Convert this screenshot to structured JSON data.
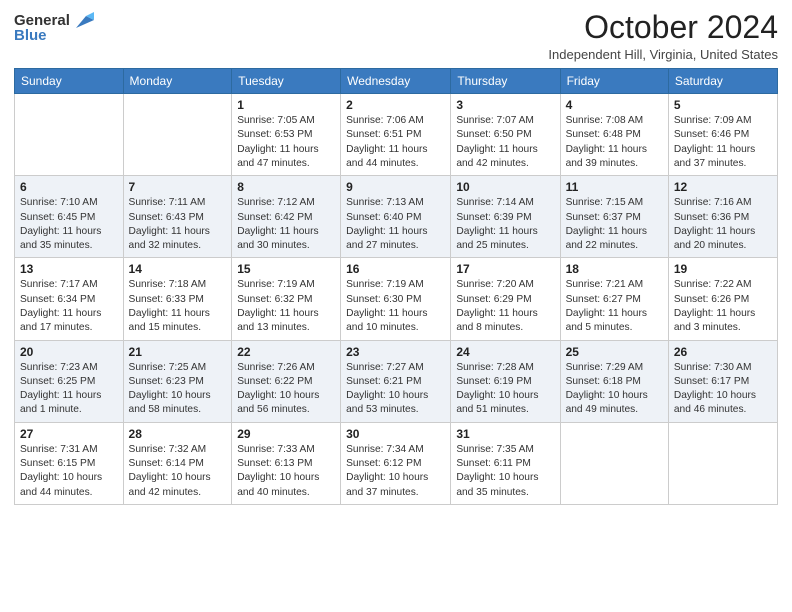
{
  "logo": {
    "general": "General",
    "blue": "Blue"
  },
  "header": {
    "title": "October 2024",
    "subtitle": "Independent Hill, Virginia, United States"
  },
  "weekdays": [
    "Sunday",
    "Monday",
    "Tuesday",
    "Wednesday",
    "Thursday",
    "Friday",
    "Saturday"
  ],
  "weeks": [
    [
      {
        "day": "",
        "detail": ""
      },
      {
        "day": "",
        "detail": ""
      },
      {
        "day": "1",
        "detail": "Sunrise: 7:05 AM\nSunset: 6:53 PM\nDaylight: 11 hours and 47 minutes."
      },
      {
        "day": "2",
        "detail": "Sunrise: 7:06 AM\nSunset: 6:51 PM\nDaylight: 11 hours and 44 minutes."
      },
      {
        "day": "3",
        "detail": "Sunrise: 7:07 AM\nSunset: 6:50 PM\nDaylight: 11 hours and 42 minutes."
      },
      {
        "day": "4",
        "detail": "Sunrise: 7:08 AM\nSunset: 6:48 PM\nDaylight: 11 hours and 39 minutes."
      },
      {
        "day": "5",
        "detail": "Sunrise: 7:09 AM\nSunset: 6:46 PM\nDaylight: 11 hours and 37 minutes."
      }
    ],
    [
      {
        "day": "6",
        "detail": "Sunrise: 7:10 AM\nSunset: 6:45 PM\nDaylight: 11 hours and 35 minutes."
      },
      {
        "day": "7",
        "detail": "Sunrise: 7:11 AM\nSunset: 6:43 PM\nDaylight: 11 hours and 32 minutes."
      },
      {
        "day": "8",
        "detail": "Sunrise: 7:12 AM\nSunset: 6:42 PM\nDaylight: 11 hours and 30 minutes."
      },
      {
        "day": "9",
        "detail": "Sunrise: 7:13 AM\nSunset: 6:40 PM\nDaylight: 11 hours and 27 minutes."
      },
      {
        "day": "10",
        "detail": "Sunrise: 7:14 AM\nSunset: 6:39 PM\nDaylight: 11 hours and 25 minutes."
      },
      {
        "day": "11",
        "detail": "Sunrise: 7:15 AM\nSunset: 6:37 PM\nDaylight: 11 hours and 22 minutes."
      },
      {
        "day": "12",
        "detail": "Sunrise: 7:16 AM\nSunset: 6:36 PM\nDaylight: 11 hours and 20 minutes."
      }
    ],
    [
      {
        "day": "13",
        "detail": "Sunrise: 7:17 AM\nSunset: 6:34 PM\nDaylight: 11 hours and 17 minutes."
      },
      {
        "day": "14",
        "detail": "Sunrise: 7:18 AM\nSunset: 6:33 PM\nDaylight: 11 hours and 15 minutes."
      },
      {
        "day": "15",
        "detail": "Sunrise: 7:19 AM\nSunset: 6:32 PM\nDaylight: 11 hours and 13 minutes."
      },
      {
        "day": "16",
        "detail": "Sunrise: 7:19 AM\nSunset: 6:30 PM\nDaylight: 11 hours and 10 minutes."
      },
      {
        "day": "17",
        "detail": "Sunrise: 7:20 AM\nSunset: 6:29 PM\nDaylight: 11 hours and 8 minutes."
      },
      {
        "day": "18",
        "detail": "Sunrise: 7:21 AM\nSunset: 6:27 PM\nDaylight: 11 hours and 5 minutes."
      },
      {
        "day": "19",
        "detail": "Sunrise: 7:22 AM\nSunset: 6:26 PM\nDaylight: 11 hours and 3 minutes."
      }
    ],
    [
      {
        "day": "20",
        "detail": "Sunrise: 7:23 AM\nSunset: 6:25 PM\nDaylight: 11 hours and 1 minute."
      },
      {
        "day": "21",
        "detail": "Sunrise: 7:25 AM\nSunset: 6:23 PM\nDaylight: 10 hours and 58 minutes."
      },
      {
        "day": "22",
        "detail": "Sunrise: 7:26 AM\nSunset: 6:22 PM\nDaylight: 10 hours and 56 minutes."
      },
      {
        "day": "23",
        "detail": "Sunrise: 7:27 AM\nSunset: 6:21 PM\nDaylight: 10 hours and 53 minutes."
      },
      {
        "day": "24",
        "detail": "Sunrise: 7:28 AM\nSunset: 6:19 PM\nDaylight: 10 hours and 51 minutes."
      },
      {
        "day": "25",
        "detail": "Sunrise: 7:29 AM\nSunset: 6:18 PM\nDaylight: 10 hours and 49 minutes."
      },
      {
        "day": "26",
        "detail": "Sunrise: 7:30 AM\nSunset: 6:17 PM\nDaylight: 10 hours and 46 minutes."
      }
    ],
    [
      {
        "day": "27",
        "detail": "Sunrise: 7:31 AM\nSunset: 6:15 PM\nDaylight: 10 hours and 44 minutes."
      },
      {
        "day": "28",
        "detail": "Sunrise: 7:32 AM\nSunset: 6:14 PM\nDaylight: 10 hours and 42 minutes."
      },
      {
        "day": "29",
        "detail": "Sunrise: 7:33 AM\nSunset: 6:13 PM\nDaylight: 10 hours and 40 minutes."
      },
      {
        "day": "30",
        "detail": "Sunrise: 7:34 AM\nSunset: 6:12 PM\nDaylight: 10 hours and 37 minutes."
      },
      {
        "day": "31",
        "detail": "Sunrise: 7:35 AM\nSunset: 6:11 PM\nDaylight: 10 hours and 35 minutes."
      },
      {
        "day": "",
        "detail": ""
      },
      {
        "day": "",
        "detail": ""
      }
    ]
  ]
}
